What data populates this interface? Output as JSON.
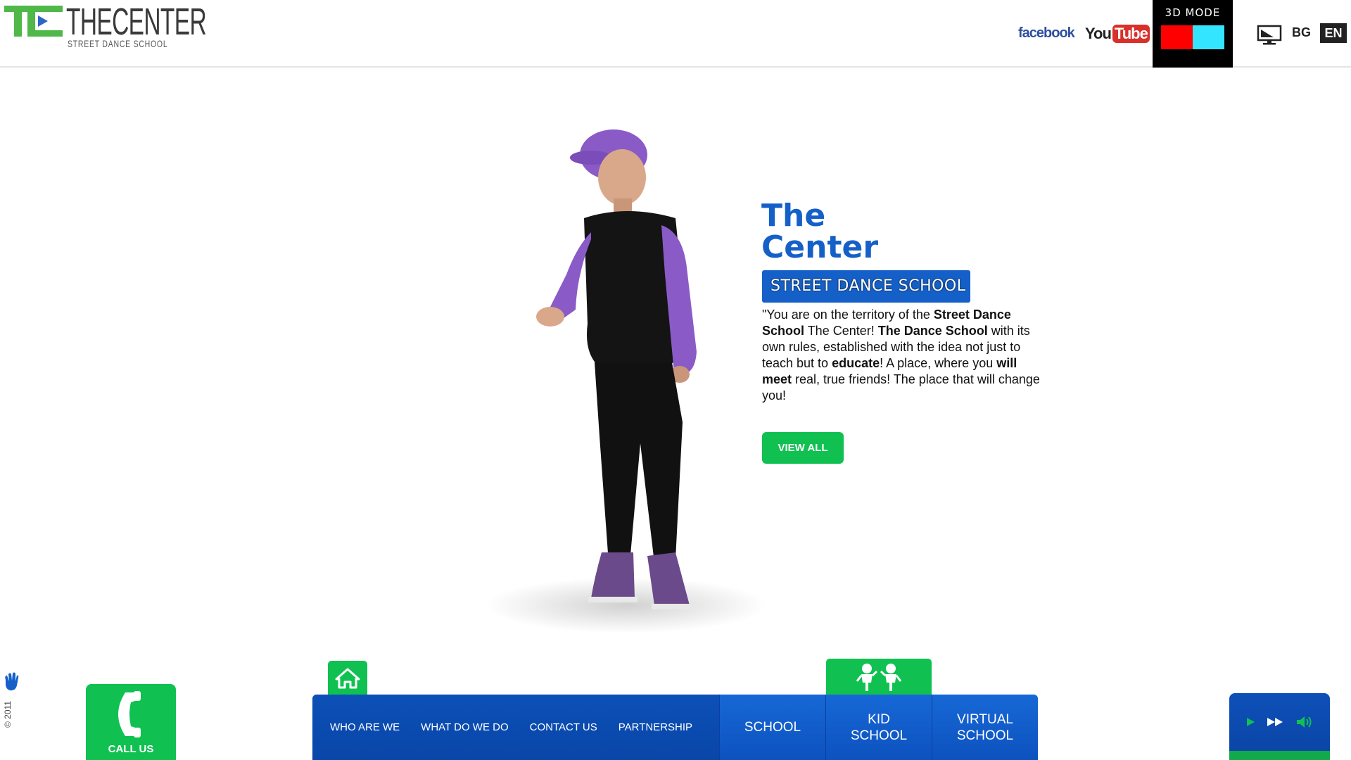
{
  "header": {
    "logo_title": "THECENTER",
    "logo_subtitle": "STREET DANCE SCHOOL",
    "facebook": "facebook",
    "youtube_you": "You",
    "youtube_tube": "Tube",
    "mode3d_label": "3D MODE",
    "lang_bg": "BG",
    "lang_en": "EN"
  },
  "hero": {
    "title_line1": "The",
    "title_line2": "Center",
    "badge": "STREET DANCE SCHOOL",
    "text": {
      "p1": "\"You are on the territory of the ",
      "b1": "Street Dance School",
      "p2": " The Center! ",
      "b2": "The Dance School",
      "p3": " with its own rules, established with the idea not just to teach but to ",
      "b3": "educate",
      "p4": "! A place, where you ",
      "b4": "will meet",
      "p5": " real, true friends! The place that will change you!"
    },
    "view_all": "VIEW ALL"
  },
  "sidebar": {
    "copyright": "© 2011",
    "call_us": "CALL US"
  },
  "nav": {
    "items": [
      "WHO ARE WE",
      "WHAT DO WE DO",
      "CONTACT US",
      "PARTNERSHIP"
    ],
    "school": "SCHOOL",
    "kid_school_1": "KID",
    "kid_school_2": "SCHOOL",
    "virtual_school_1": "VIRTUAL",
    "virtual_school_2": "SCHOOL"
  },
  "icons": {
    "home": "home-icon",
    "kids": "kids-icon",
    "phone": "phone-icon",
    "hand": "hand-icon",
    "monitor": "monitor-icon",
    "play": "play-icon",
    "fast_forward": "fast-forward-icon",
    "volume": "volume-icon"
  },
  "colors": {
    "brand_blue": "#1560c8",
    "nav_blue": "#0a4cb5",
    "brand_green": "#10c152",
    "mode_red": "#ff0000",
    "mode_cyan": "#33e5ff"
  }
}
